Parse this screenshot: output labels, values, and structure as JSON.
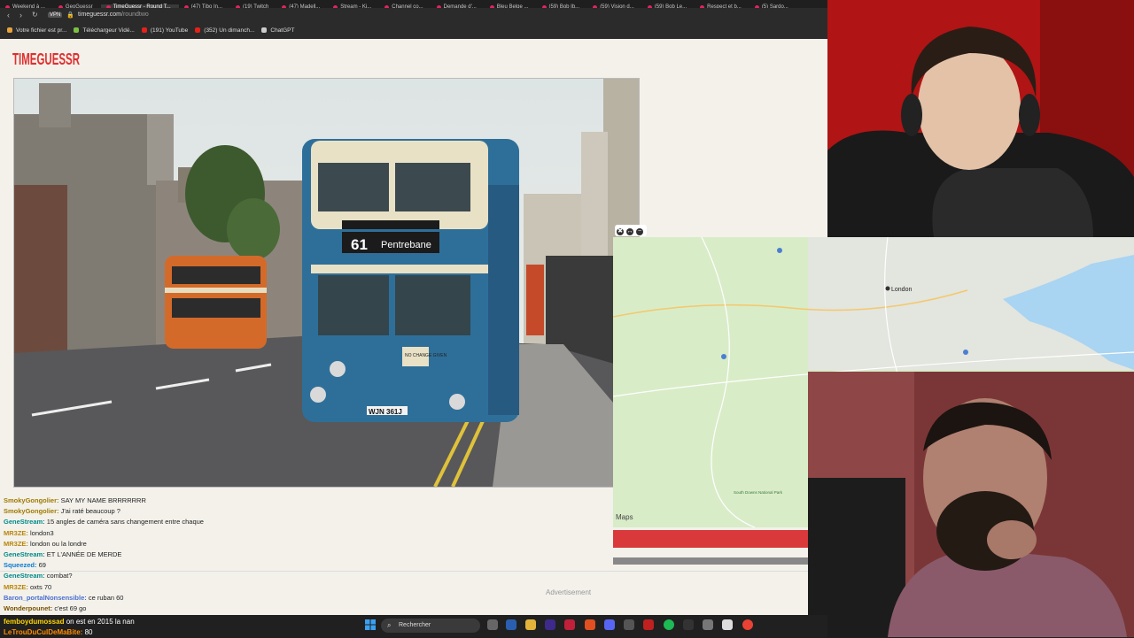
{
  "browser": {
    "tabs": [
      "Weekend à ...",
      "GeoGuessr",
      "TimeGuessr - Round T...",
      "(47) Tibo In...",
      "(19) Twitch",
      "(47) Madell...",
      "Stream - Ki...",
      "Channel co...",
      "Demande d'...",
      "Bleu Belge ...",
      "(59) Bob Ib...",
      "(59) Vision d...",
      "(59) Bob Le...",
      "Respect et b...",
      "(5) Sardo..."
    ],
    "url_host": "timeguessr.com",
    "url_path": "/roundtwo",
    "bookmarks": [
      {
        "label": "Votre fichier est pr...",
        "color": "#e8a33c"
      },
      {
        "label": "Téléchargeur Vidé...",
        "color": "#7cc242"
      },
      {
        "label": "(191) YouTube",
        "color": "#e62117"
      },
      {
        "label": "(352) Un dimanch...",
        "color": "#e62117"
      },
      {
        "label": "ChatGPT",
        "color": "#cccccc"
      }
    ]
  },
  "site": {
    "logo": "TIMEGUESSR",
    "ad_label": "Advertisement",
    "bus": {
      "route": "61",
      "destination": "Pentrebane",
      "plate": "WJN 361J",
      "sign": "NO CHANGE GIVEN"
    }
  },
  "map": {
    "city": "London",
    "brand": "Maps",
    "park": "South Downs National Park"
  },
  "chat": [
    {
      "user": "SmokyGongolier:",
      "text": "SAY MY NAME BRRRRRRR",
      "color": "#a07a00"
    },
    {
      "user": "SmokyGongolier:",
      "text": "J'ai raté beaucoup ?",
      "color": "#a07a00"
    },
    {
      "user": "GeneStream:",
      "text": "15 angles de caméra sans changement entre chaque",
      "color": "#008a8a"
    },
    {
      "user": "MR3ZE:",
      "text": "london3",
      "color": "#b8860b"
    },
    {
      "user": "MR3ZE:",
      "text": "london ou la londre",
      "color": "#b8860b"
    },
    {
      "user": "GeneStream:",
      "text": "ET L'ANNÉE DE MERDE",
      "color": "#008a8a"
    },
    {
      "user": "Squeezed:",
      "text": "69",
      "color": "#0a7bd1"
    },
    {
      "user": "GeneStream:",
      "text": "combat?",
      "color": "#008a8a"
    },
    {
      "user": "MR3ZE:",
      "text": "oxts 70",
      "color": "#b8860b"
    },
    {
      "user": "Baron_portalNonsensible:",
      "text": "ce ruban 60",
      "color": "#4a6fd1"
    },
    {
      "user": "Wonderpounet:",
      "text": "c'est 69 go",
      "color": "#7a5200"
    }
  ],
  "bottom_chat": [
    {
      "user": "femboydumossad",
      "text": "on est en 2015 la nan",
      "color": "#ffd400"
    },
    {
      "user": "LeTrouDuCulDeMaBite:",
      "text": "80",
      "color": "#ff8c00"
    }
  ],
  "taskbar": {
    "search_placeholder": "Rechercher"
  }
}
